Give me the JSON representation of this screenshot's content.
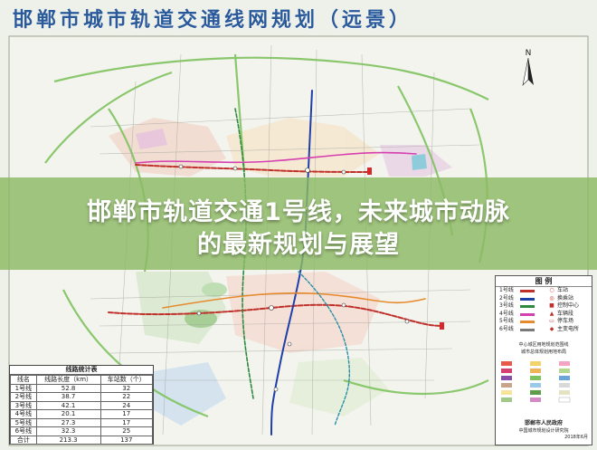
{
  "map": {
    "title": "邯郸市城市轨道交通线网规划（远景）",
    "title_color": "#2a5a9a",
    "compass_icon": "north-arrow-icon",
    "compass_label": "N"
  },
  "banner": {
    "line1": "邯郸市轨道交通1号线，未来城市动脉",
    "line2": "的最新规划与展望",
    "background": "#8cb964"
  },
  "stats_table": {
    "caption": "线路统计表",
    "headers": [
      "线名",
      "线路长度（km）",
      "车站数（个）"
    ],
    "rows": [
      [
        "1号线",
        "52.8",
        "32"
      ],
      [
        "2号线",
        "38.7",
        "22"
      ],
      [
        "3号线",
        "42.1",
        "24"
      ],
      [
        "4号线",
        "20.1",
        "17"
      ],
      [
        "5号线",
        "27.3",
        "17"
      ],
      [
        "6号线",
        "32.3",
        "25"
      ],
      [
        "合计",
        "213.3",
        "137"
      ]
    ]
  },
  "legend": {
    "title": "图 例",
    "lines": [
      {
        "name": "1号线",
        "color": "#c0302a"
      },
      {
        "name": "2号线",
        "color": "#1f3fa8"
      },
      {
        "name": "3号线",
        "color": "#2b8a3e"
      },
      {
        "name": "4号线",
        "color": "#d63fb0"
      },
      {
        "name": "5号线",
        "color": "#e68a2e"
      },
      {
        "name": "6号线",
        "color": "#7a7a7a"
      }
    ],
    "symbols": [
      "车站",
      "换乘站",
      "控制中心",
      "车辆段",
      "停车场",
      "主变电所"
    ],
    "note1": "中心城区用地规划范围线",
    "note2": "城市总体规划用地布局",
    "footer": "邯郸市人民政府",
    "footer2": "中国城市规划设计研究院",
    "date": "2018年6月"
  }
}
